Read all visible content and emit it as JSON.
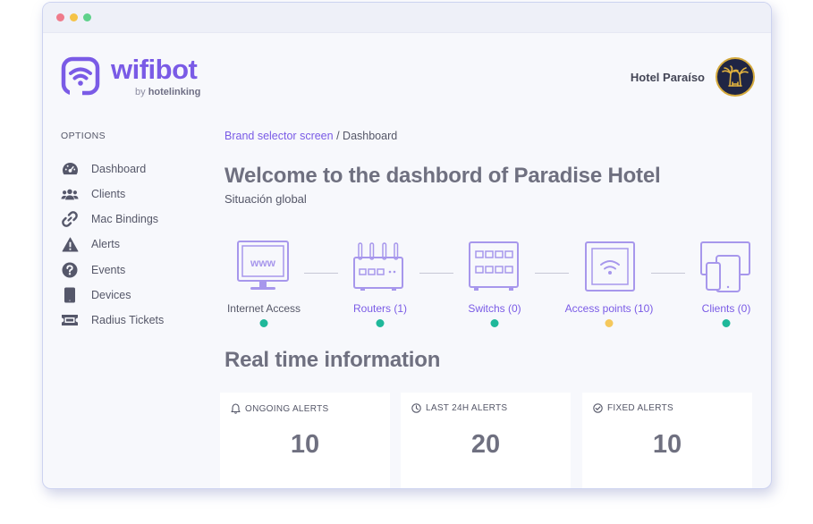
{
  "brand": {
    "name": "wifibot",
    "by": "by",
    "by_company": "hotelinking"
  },
  "header": {
    "hotel_name": "Hotel Paraíso"
  },
  "sidebar": {
    "title": "OPTIONS",
    "items": [
      {
        "label": "Dashboard",
        "icon": "dashboard-gauge-icon"
      },
      {
        "label": "Clients",
        "icon": "users-icon"
      },
      {
        "label": "Mac Bindings",
        "icon": "link-icon"
      },
      {
        "label": "Alerts",
        "icon": "warning-icon"
      },
      {
        "label": "Events",
        "icon": "question-icon"
      },
      {
        "label": "Devices",
        "icon": "device-icon"
      },
      {
        "label": "Radius Tickets",
        "icon": "ticket-icon"
      }
    ]
  },
  "breadcrumb": {
    "link": "Brand selector screen",
    "separator": "/",
    "current": "Dashboard"
  },
  "main": {
    "title": "Welcome to the dashbord of Paradise Hotel",
    "subtitle": "Situación global",
    "network": [
      {
        "label": "Internet Access",
        "icon": "www-monitor-icon",
        "status": "#1fb89a"
      },
      {
        "label": "Routers (1)",
        "icon": "router-icon",
        "status": "#1fb89a"
      },
      {
        "label": "Switchs (0)",
        "icon": "switch-icon",
        "status": "#1fb89a"
      },
      {
        "label": "Access points (10)",
        "icon": "access-point-icon",
        "status": "#f5c85c"
      },
      {
        "label": "Clients (0)",
        "icon": "client-devices-icon",
        "status": "#1fb89a"
      }
    ],
    "www_text": "www",
    "realtime_title": "Real time information",
    "cards": [
      {
        "label": "ONGOING ALERTS",
        "value": "10",
        "icon": "bell-icon"
      },
      {
        "label": "LAST 24H ALERTS",
        "value": "20",
        "icon": "clock-icon"
      },
      {
        "label": "FIXED ALERTS",
        "value": "10",
        "icon": "check-circle-icon"
      }
    ]
  },
  "colors": {
    "accent": "#7a5be6",
    "ok": "#1fb89a",
    "warn": "#f5c85c",
    "text": "#555768",
    "heading": "#6f7080"
  }
}
